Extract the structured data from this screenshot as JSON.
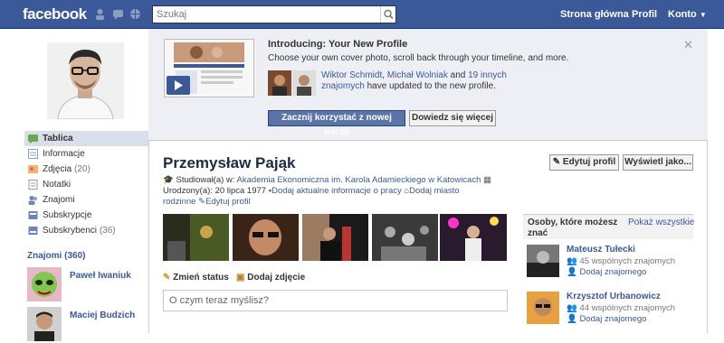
{
  "topbar": {
    "logo": "facebook",
    "search_placeholder": "Szukaj",
    "home": "Strona główna",
    "profile": "Profil",
    "account": "Konto"
  },
  "colors": {
    "brand": "#3b5998",
    "active_nav": "#d8dfea",
    "banner": "#edeff4"
  },
  "intro": {
    "title": "Introducing: Your New Profile",
    "subtitle": "Choose your own cover photo, scroll back through your timeline, and more.",
    "friend1": "Wiktor Schmidt",
    "friend2": "Michał Wolniak",
    "and": " and ",
    "comma": ", ",
    "others": "19 innych znajomych",
    "tail": " have updated to the new profile.",
    "start_button": "Zacznij korzystać z nowej wersji",
    "learn_button": "Dowiedz się więcej"
  },
  "left_nav": [
    {
      "label": "Tablica",
      "count": "",
      "icon": "wall-icon"
    },
    {
      "label": "Informacje",
      "count": "",
      "icon": "info-icon"
    },
    {
      "label": "Zdjęcia",
      "count": "(20)",
      "icon": "photos-icon"
    },
    {
      "label": "Notatki",
      "count": "",
      "icon": "notes-icon"
    },
    {
      "label": "Znajomi",
      "count": "",
      "icon": "friends-icon"
    },
    {
      "label": "Subskrypcje",
      "count": "",
      "icon": "subscriptions-icon"
    },
    {
      "label": "Subskrybenci",
      "count": "(36)",
      "icon": "subscribers-icon"
    }
  ],
  "friends": {
    "header": "Znajomi (360)",
    "items": [
      {
        "name": "Paweł Iwaniuk"
      },
      {
        "name": "Maciej Budzich"
      }
    ]
  },
  "profile": {
    "name": "Przemysław Pająk",
    "edit_profile": "Edytuj profil",
    "view_as": "Wyświetl jako...",
    "studied_prefix": "Studiował(a) w: ",
    "school": "Akademia Ekonomiczna im. Karola Adamieckiego w Katowicach",
    "born": "Urodzony(a): 20 lipca 1977",
    "add_work": "Dodaj aktualne informacje o pracy",
    "add_hometown_a": "Dodaj miasto",
    "add_hometown_b": "rodzinne",
    "edit_profile_inline": "Edytuj profil"
  },
  "status": {
    "tab_status": "Zmień status",
    "tab_photo": "Dodaj zdjęcie",
    "placeholder": "O czym teraz myślisz?"
  },
  "suggestions": {
    "title_a": "Osoby, które możesz",
    "title_b": "znać",
    "see_all": "Pokaż wszystkie",
    "items": [
      {
        "name": "Mateusz Tułecki",
        "mutual": "45 wspólnych znajomych",
        "add": "Dodaj znajomego"
      },
      {
        "name": "Krzysztof Urbanowicz",
        "mutual": "44 wspólnych znajomych",
        "add": "Dodaj znajomego"
      }
    ]
  }
}
